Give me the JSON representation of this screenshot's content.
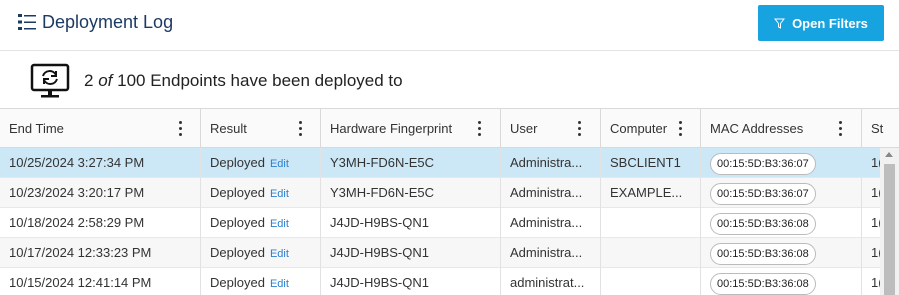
{
  "header": {
    "title": "Deployment Log",
    "filter_label": "Open Filters"
  },
  "summary": {
    "count": "2",
    "of": "of",
    "rest": "100 Endpoints have been deployed to"
  },
  "columns": [
    "End Time",
    "Result",
    "Hardware Fingerprint",
    "User",
    "Computer",
    "MAC Addresses",
    "St"
  ],
  "rows": [
    {
      "end_time": "10/25/2024 3:27:34 PM",
      "result": "Deployed",
      "edit": "Edit",
      "fingerprint": "Y3MH-FD6N-E5C",
      "user": "Administra...",
      "computer": "SBCLIENT1",
      "mac": "00:15:5D:B3:36:07",
      "status": "1("
    },
    {
      "end_time": "10/23/2024 3:20:17 PM",
      "result": "Deployed",
      "edit": "Edit",
      "fingerprint": "Y3MH-FD6N-E5C",
      "user": "Administra...",
      "computer": "EXAMPLE...",
      "mac": "00:15:5D:B3:36:07",
      "status": "1("
    },
    {
      "end_time": "10/18/2024 2:58:29 PM",
      "result": "Deployed",
      "edit": "Edit",
      "fingerprint": "J4JD-H9BS-QN1",
      "user": "Administra...",
      "computer": "",
      "mac": "00:15:5D:B3:36:08",
      "status": "1("
    },
    {
      "end_time": "10/17/2024 12:33:23 PM",
      "result": "Deployed",
      "edit": "Edit",
      "fingerprint": "J4JD-H9BS-QN1",
      "user": "Administra...",
      "computer": "",
      "mac": "00:15:5D:B3:36:08",
      "status": "1("
    },
    {
      "end_time": "10/15/2024 12:41:14 PM",
      "result": "Deployed",
      "edit": "Edit",
      "fingerprint": "J4JD-H9BS-QN1",
      "user": "administrat...",
      "computer": "",
      "mac": "00:15:5D:B3:36:08",
      "status": "1("
    }
  ],
  "icons": {
    "title": "list-icon",
    "filter": "filter-icon",
    "summary": "monitor-sync-icon",
    "menu": "kebab-menu-icon"
  },
  "colors": {
    "accent": "#17a2e0",
    "title": "#1d3a63",
    "selected_row": "#cce7f6",
    "link": "#2a7fd0"
  }
}
